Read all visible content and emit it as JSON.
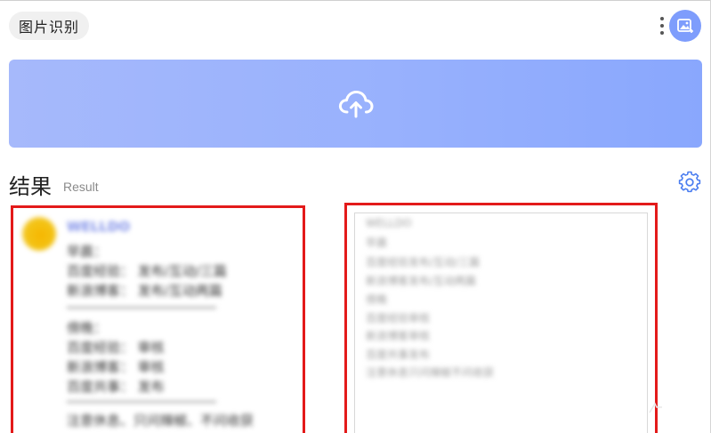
{
  "app": {
    "title": "图片识别"
  },
  "icons": {
    "more": "more-vertical-icon",
    "avatar": "image-gallery-icon",
    "upload": "cloud-upload-icon",
    "settings": "gear-icon"
  },
  "colors": {
    "accent": "#7e9dfc",
    "upload_gradient_start": "#a6b9fb",
    "upload_gradient_end": "#89a7fd",
    "highlight_border": "#e31a1a"
  },
  "result": {
    "title": "结果",
    "subtitle": "Result"
  },
  "left_panel": {
    "sender": "WELLDO",
    "lines": [
      "早晨：",
      "百度经验：  发布/互动/三篇",
      "新浪博客：  发布/互动两篇",
      "傍晚：",
      "百度经验：  审核",
      "新浪博客：  审核",
      "百度共事：  发布",
      "注意休息、只问辣椒、不问收获"
    ]
  },
  "right_panel": {
    "lines": [
      "WELLDO",
      "早晨",
      "百度经验发布/互动/三篇",
      "新浪博客发布/互动两篇",
      "傍晚",
      "百度经验审核",
      "新浪博客审核",
      "百度共事发布",
      "注意休息只问辣椒不问收获"
    ]
  }
}
